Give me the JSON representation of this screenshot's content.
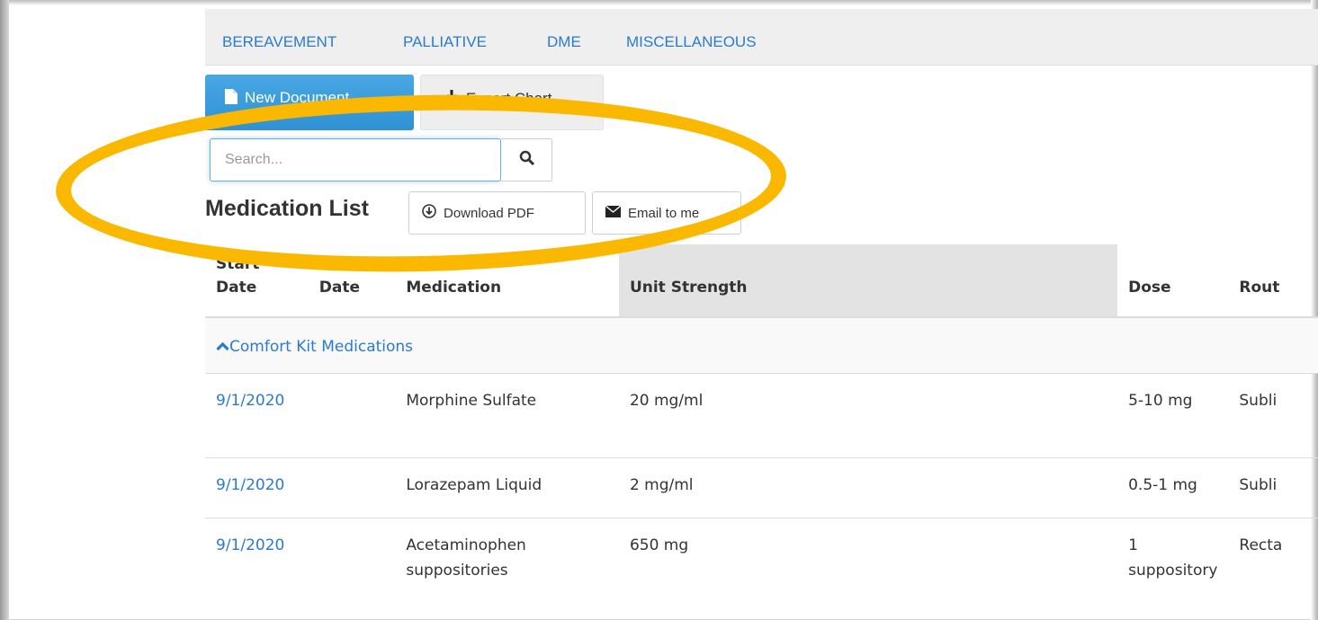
{
  "nav_tabs": [
    "BEREAVEMENT",
    "PALLIATIVE",
    "DME",
    "MISCELLANEOUS"
  ],
  "toolbar": {
    "new_document_label": "New Document",
    "export_chart_label": "Export Chart"
  },
  "search": {
    "placeholder": "Search..."
  },
  "medication_list": {
    "title": "Medication List",
    "download_pdf_label": "Download PDF",
    "email_label": "Email to me",
    "columns": {
      "start_date": "Start Date",
      "dc_date": "D/C Date",
      "medication": "Medication",
      "unit_strength": "Unit Strength",
      "dose": "Dose",
      "route": "Rout"
    },
    "group_label": "Comfort Kit Medications",
    "rows": [
      {
        "start_date": "9/1/2020",
        "dc_date": "",
        "medication": "Morphine Sulfate",
        "unit_strength": "20 mg/ml",
        "dose": "5-10 mg",
        "route": "Subli"
      },
      {
        "start_date": "9/1/2020",
        "dc_date": "",
        "medication": "Lorazepam Liquid",
        "unit_strength": "2 mg/ml",
        "dose": "0.5-1 mg",
        "route": "Subli"
      },
      {
        "start_date": "9/1/2020",
        "dc_date": "",
        "medication": "Acetaminophen suppositories",
        "unit_strength": "650 mg",
        "dose": "1 suppository",
        "route": "Recta"
      }
    ]
  },
  "colors": {
    "link": "#2a7bd0",
    "primary_button": "#3a9ddc",
    "highlight_ring": "#fbb800",
    "sorted_column": "#e3e3e3"
  }
}
